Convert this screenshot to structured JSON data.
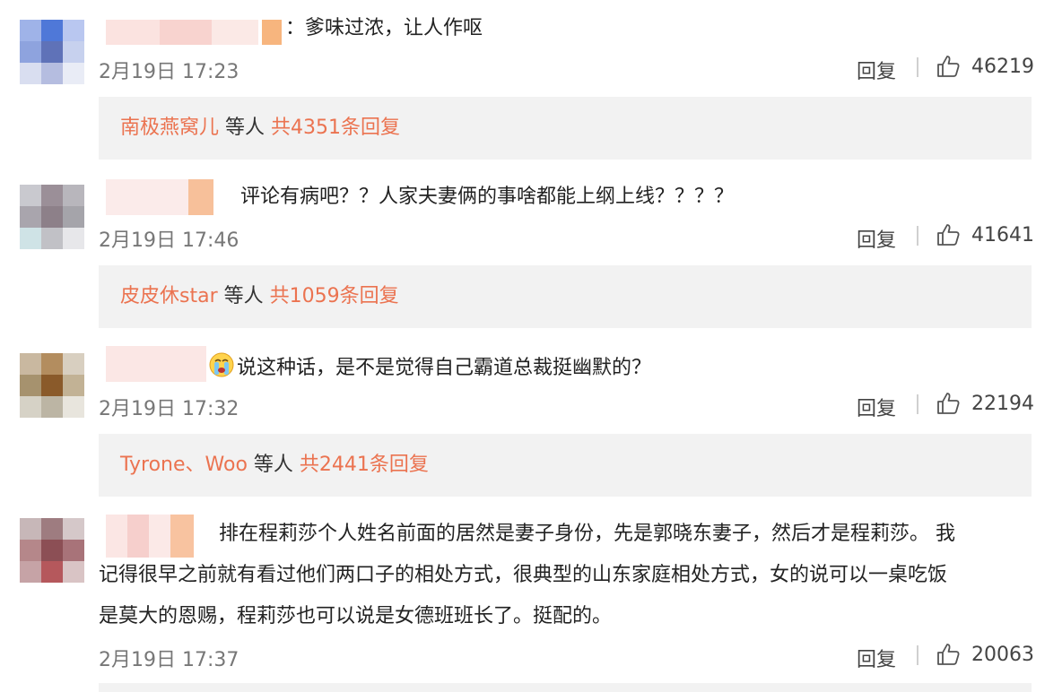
{
  "comments": [
    {
      "text": "：爹味过浓，让人作呕",
      "time": "2月19日 17:23",
      "reply_label": "回复",
      "likes": "46219",
      "thread": {
        "names": "南极燕窝儿",
        "mid": " 等人 ",
        "count": "共4351条回复"
      }
    },
    {
      "text": "评论有病吧？？人家夫妻俩的事啥都能上纲上线？？？？",
      "time": "2月19日 17:46",
      "reply_label": "回复",
      "likes": "41641",
      "thread": {
        "names": "皮皮休star",
        "mid": " 等人 ",
        "count": "共1059条回复"
      }
    },
    {
      "text": "说这种话，是不是觉得自己霸道总裁挺幽默的？",
      "emoji": "crying-face-emoji",
      "time": "2月19日 17:32",
      "reply_label": "回复",
      "likes": "22194",
      "thread": {
        "names": "Tyrone、Woo",
        "mid": " 等人 ",
        "count": "共2441条回复"
      }
    },
    {
      "lines": [
        "排在程莉莎个人姓名前面的居然是妻子身份，先是郭晓东妻子，然后才是程莉莎。 我",
        "记得很早之前就有看过他们两口子的相处方式，很典型的山东家庭相处方式，女的说可以一桌吃饭",
        "是莫大的恩赐，程莉莎也可以说是女德班班长了。挺配的。"
      ],
      "time": "2月19日 17:37",
      "reply_label": "回复",
      "likes": "20063"
    }
  ],
  "colors": {
    "accent": "#eb7350",
    "reply_bg": "#f2f2f2",
    "meta": "#777777"
  },
  "icons": {
    "like": "thumbs-up-icon"
  }
}
